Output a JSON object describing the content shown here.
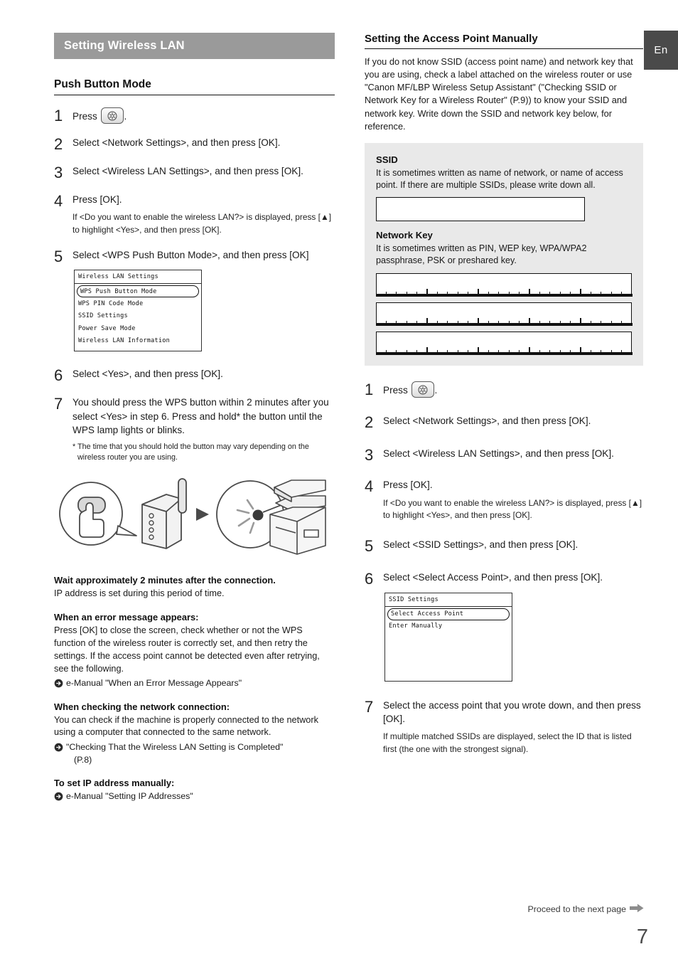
{
  "lang_tab": "En",
  "page_number": "7",
  "footer": {
    "proceed_text": "Proceed to the next page"
  },
  "left_column": {
    "section_bar": "Setting Wireless LAN",
    "sub_heading": "Push Button Mode",
    "steps": [
      {
        "num": "1",
        "text_before": "Press",
        "has_key_icon": true,
        "text_after": "."
      },
      {
        "num": "2",
        "text": "Select <Network Settings>, and then press [OK]."
      },
      {
        "num": "3",
        "text": "Select <Wireless LAN Settings>, and then press [OK]."
      },
      {
        "num": "4",
        "text": "Press [OK].",
        "sub": "If <Do you want to enable the wireless LAN?> is displayed, press [▲] to highlight <Yes>, and then press [OK]."
      },
      {
        "num": "5",
        "text": "Select <WPS Push Button Mode>, and then press [OK]"
      },
      {
        "num": "6",
        "text": "Select <Yes>, and then press [OK]."
      },
      {
        "num": "7",
        "text": "You should press the WPS button within 2 minutes after you select <Yes> in step 6. Press and hold* the button until the WPS lamp lights or blinks.",
        "note": "* The time that you should hold the button may vary depending on the wireless router you are using."
      }
    ],
    "lcd": {
      "title": "Wireless LAN Settings",
      "items": [
        {
          "label": "WPS Push Button Mode",
          "selected": true
        },
        {
          "label": "WPS PIN Code Mode",
          "selected": false
        },
        {
          "label": "SSID Settings",
          "selected": false
        },
        {
          "label": "Power Save Mode",
          "selected": false
        },
        {
          "label": "Wireless LAN Information",
          "selected": false
        }
      ]
    },
    "blocks": [
      {
        "heading": "Wait approximately 2 minutes after the connection.",
        "body": "IP address is set during this period of time.",
        "refs": []
      },
      {
        "heading": "When an error message appears:",
        "body": "Press [OK] to close the screen, check whether or not the WPS function of the wireless router is correctly set, and then retry the settings. If the access point cannot be detected even after retrying, see the following.",
        "refs": [
          {
            "text": "e-Manual \"When an Error Message Appears\"",
            "cont": ""
          }
        ]
      },
      {
        "heading": "When checking the network connection:",
        "body": "You can check if the machine is properly connected to the network using a computer that connected to the same network.",
        "refs": [
          {
            "text": "\"Checking That the Wireless LAN Setting is Completed\"",
            "cont": "(P.8)"
          }
        ]
      },
      {
        "heading": "To set IP address manually:",
        "body": "",
        "refs": [
          {
            "text": "e-Manual \"Setting IP Addresses\"",
            "cont": ""
          }
        ]
      }
    ]
  },
  "right_column": {
    "heading": "Setting the Access Point Manually",
    "intro": "If you do not know SSID (access point name) and network key that you are using, check a label attached on the wireless router or use \"Canon MF/LBP Wireless Setup Assistant\" (\"Checking SSID or Network Key for a Wireless Router\" (P.9)) to know your SSID and network key. Write down the SSID and network key below, for reference.",
    "infobox": {
      "ssid_title": "SSID",
      "ssid_desc": "It is sometimes written as name of network, or name of access point. If there are multiple SSIDs, please write down all.",
      "key_title": "Network Key",
      "key_desc": "It is sometimes written as PIN, WEP key, WPA/WPA2 passphrase, PSK or preshared key.",
      "key_field_count": 3
    },
    "steps": [
      {
        "num": "1",
        "text_before": "Press",
        "has_key_icon": true,
        "text_after": "."
      },
      {
        "num": "2",
        "text": "Select <Network Settings>, and then press [OK]."
      },
      {
        "num": "3",
        "text": "Select <Wireless LAN Settings>, and then press [OK]."
      },
      {
        "num": "4",
        "text": "Press [OK].",
        "sub": "If <Do you want to enable the wireless LAN?> is displayed, press [▲] to highlight <Yes>, and then press [OK]."
      },
      {
        "num": "5",
        "text": "Select <SSID Settings>, and then press [OK]."
      },
      {
        "num": "6",
        "text": "Select <Select Access Point>, and then press [OK]."
      },
      {
        "num": "7",
        "text": "Select the access point that you wrote down, and then press [OK].",
        "sub": "If multiple matched SSIDs are displayed, select the ID that is listed first (the one with the strongest signal)."
      }
    ],
    "lcd": {
      "title": "SSID Settings",
      "items": [
        {
          "label": "Select Access Point",
          "selected": true
        },
        {
          "label": "Enter Manually",
          "selected": false
        }
      ]
    }
  },
  "colors": {
    "section_bar": "#9a9a9a",
    "lang_tab": "#4a4a4a",
    "infobox": "#e9e9e9",
    "text": "#1a1a1a"
  }
}
